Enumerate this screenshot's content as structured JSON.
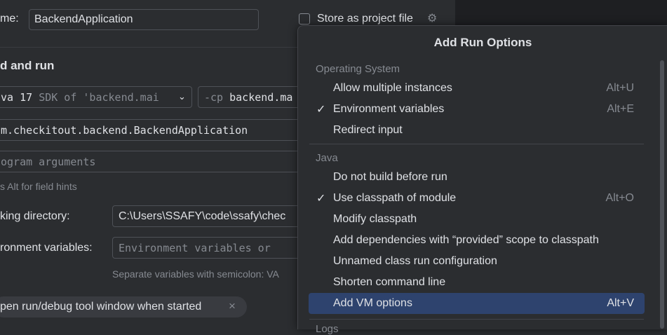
{
  "dialog": {
    "name_label": "me:",
    "name_value": "BackendApplication",
    "store_as_project_file": "Store as project file",
    "section_title": "d and run",
    "jdk_prefix": "va 17",
    "jdk_detail": "SDK of 'backend.mai",
    "cp_prefix": "-cp",
    "cp_value": "backend.ma",
    "main_class": "m.checkitout.backend.BackendApplication",
    "program_args_placeholder": "ogram arguments",
    "field_hint": "s Alt for field hints",
    "working_dir_label": "king directory:",
    "working_dir_value": "C:\\Users\\SSAFY\\code\\ssafy\\chec",
    "env_label": "ronment variables:",
    "env_placeholder": "Environment variables or",
    "env_hint": "Separate variables with semicolon: VA",
    "open_window_tag": "pen run/debug tool window when started",
    "close_glyph": "×"
  },
  "popup": {
    "title": "Add Run Options",
    "groups": [
      {
        "name": "Operating System",
        "items": [
          {
            "label": "Allow multiple instances",
            "shortcut": "Alt+U",
            "checked": false
          },
          {
            "label": "Environment variables",
            "shortcut": "Alt+E",
            "checked": true
          },
          {
            "label": "Redirect input",
            "shortcut": "",
            "checked": false
          }
        ]
      },
      {
        "name": "Java",
        "items": [
          {
            "label": "Do not build before run",
            "shortcut": "",
            "checked": false
          },
          {
            "label": "Use classpath of module",
            "shortcut": "Alt+O",
            "checked": true
          },
          {
            "label": "Modify classpath",
            "shortcut": "",
            "checked": false
          },
          {
            "label": "Add dependencies with “provided” scope to classpath",
            "shortcut": "",
            "checked": false
          },
          {
            "label": "Unnamed class run configuration",
            "shortcut": "",
            "checked": false
          },
          {
            "label": "Shorten command line",
            "shortcut": "",
            "checked": false
          },
          {
            "label": "Add VM options",
            "shortcut": "Alt+V",
            "checked": false,
            "selected": true
          }
        ]
      }
    ],
    "next_group_partial": "Logs"
  },
  "colors": {
    "background": "#2b2d30",
    "selection": "#2e436e",
    "text": "#dfe1e5",
    "muted": "#868a91"
  }
}
